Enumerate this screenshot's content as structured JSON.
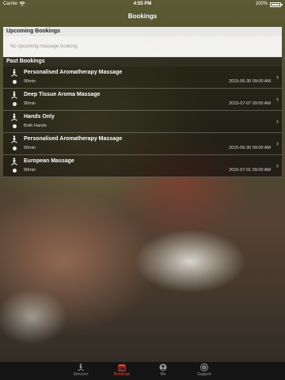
{
  "status": {
    "carrier": "Carrier",
    "time": "4:55 PM",
    "battery": "100%"
  },
  "nav": {
    "title": "Bookings"
  },
  "upcoming": {
    "header": "Upcoming Bookings",
    "empty": "No upcoming massage booking."
  },
  "past": {
    "header": "Past Bookings",
    "items": [
      {
        "title": "Personalised Aromatherapy Massage",
        "detail": "90min",
        "date": "2015-06-30 09:00 AM"
      },
      {
        "title": "Deep Tissue Aroma Massage",
        "detail": "90min",
        "date": "2015-07-07 09:00 AM"
      },
      {
        "title": "Hands Only",
        "detail": "Both Hands",
        "date": ""
      },
      {
        "title": "Personalised Aromatherapy Massage",
        "detail": "90min",
        "date": "2015-06-30 09:00 AM"
      },
      {
        "title": "European Massage",
        "detail": "90min",
        "date": "2015-07-01 09:00 AM"
      }
    ]
  },
  "tabs": [
    {
      "label": "Services",
      "icon": "massage-icon"
    },
    {
      "label": "Bookings",
      "icon": "calendar-icon"
    },
    {
      "label": "Me",
      "icon": "person-icon"
    },
    {
      "label": "Support",
      "icon": "info-icon"
    }
  ],
  "colors": {
    "accent": "#e8452f"
  }
}
